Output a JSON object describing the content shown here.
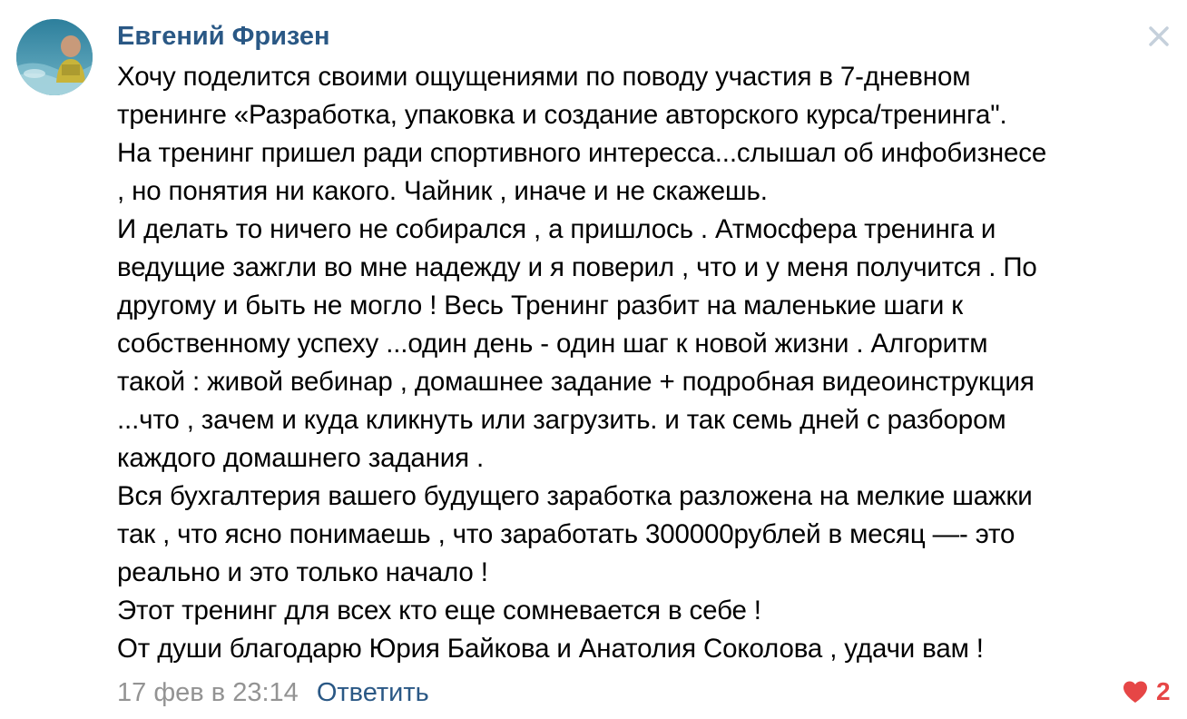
{
  "comment": {
    "author": "Евгений Фризен",
    "avatar_icon": "user-photo-avatar",
    "lines": [
      "Хочу поделится своими ощущениями по поводу участия в 7-дневном",
      "тренинге «Разработка, упаковка и создание авторского курса/тренинга\".",
      "На тренинг пришел ради спортивного интересса...слышал об инфобизнесе",
      ", но понятия ни какого. Чайник , иначе и не скажешь.",
      "И делать то ничего не собирался , а пришлось . Атмосфера тренинга и",
      "ведущие зажгли во мне надежду и я поверил , что и у меня получится . По",
      "другому и быть не могло ! Весь Тренинг разбит на маленькие шаги к",
      "собственному успеху ...один день - один шаг к новой жизни . Алгоритм",
      "такой : живой вебинар , домашнее задание + подробная видеоинструкция",
      "...что , зачем и куда кликнуть или загрузить. и так семь дней с разбором",
      "каждого домашнего задания .",
      "Вся бухгалтерия вашего будущего заработка разложена на мелкие шажки",
      "так , что ясно понимаешь , что заработать 300000рублей в месяц —- это",
      "реально и это только начало !",
      "Этот тренинг для всех кто еще сомневается в себе !",
      "От души благодарю Юрия Байкова и Анатолия Соколова , удачи вам !"
    ],
    "date": "17 фев в 23:14",
    "reply_label": "Ответить",
    "likes": "2",
    "close_icon": "close-icon",
    "like_icon": "heart-icon"
  },
  "colors": {
    "author": "#2a5885",
    "reply": "#2a5885",
    "date": "#939393",
    "like": "#e64646",
    "close": "#c5d0db"
  }
}
